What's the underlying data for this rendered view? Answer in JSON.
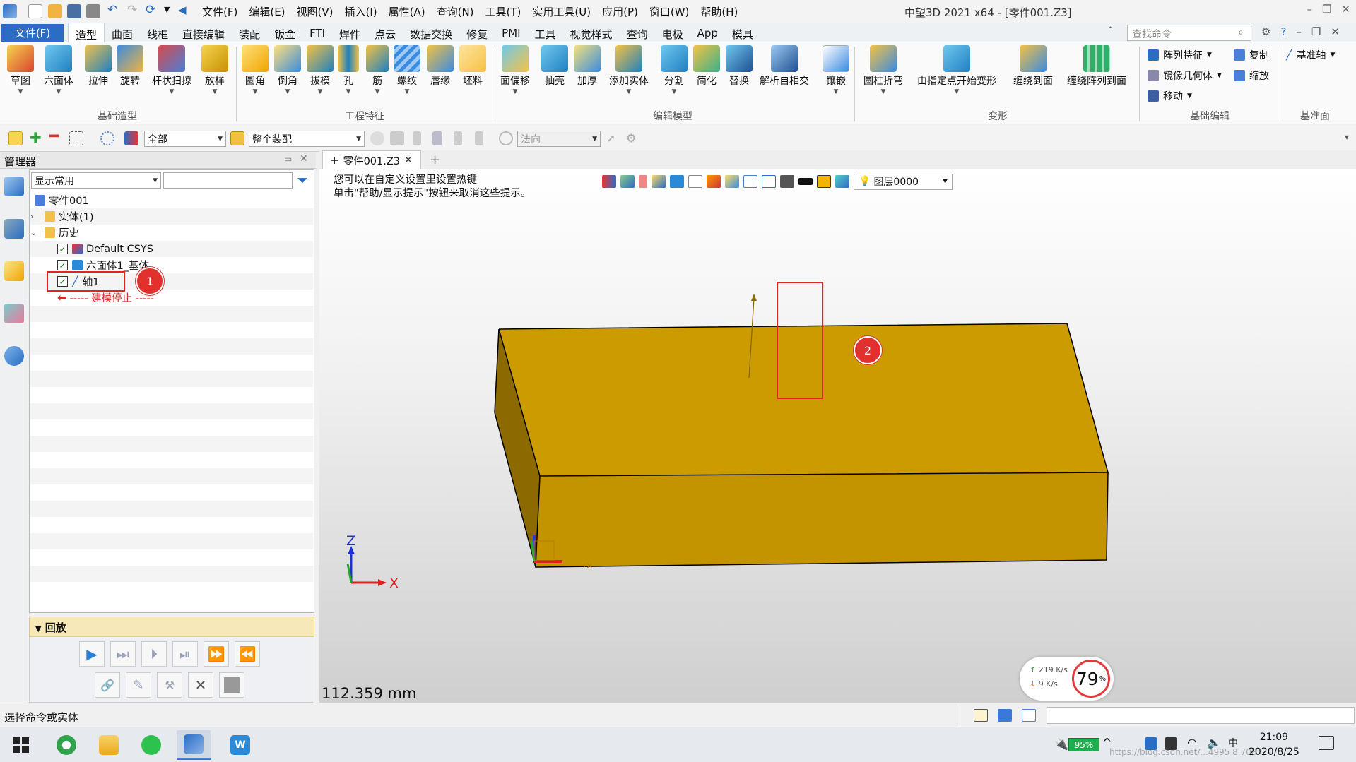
{
  "menu": [
    "文件(F)",
    "编辑(E)",
    "视图(V)",
    "插入(I)",
    "属性(A)",
    "查询(N)",
    "工具(T)",
    "实用工具(U)",
    "应用(P)",
    "窗口(W)",
    "帮助(H)"
  ],
  "window_title": "中望3D 2021 x64 - [零件001.Z3]",
  "tabs": {
    "file": "文件(F)",
    "items": [
      "造型",
      "曲面",
      "线框",
      "直接编辑",
      "装配",
      "钣金",
      "FTI",
      "焊件",
      "点云",
      "数据交换",
      "修复",
      "PMI",
      "工具",
      "视觉样式",
      "查询",
      "电极",
      "App",
      "模具"
    ],
    "active": "造型"
  },
  "search": {
    "placeholder": "查找命令"
  },
  "ribbon": {
    "groups": [
      "基础造型",
      "工程特征",
      "编辑模型",
      "变形",
      "基础编辑",
      "基准面"
    ],
    "basic": [
      "草图",
      "六面体",
      "拉伸",
      "旋转",
      "杆状扫掠",
      "放样"
    ],
    "engineering": [
      "圆角",
      "倒角",
      "拔模",
      "孔",
      "筋",
      "螺纹",
      "唇缘",
      "坯料"
    ],
    "edit": [
      "面偏移",
      "抽壳",
      "加厚",
      "添加实体",
      "分割",
      "简化",
      "替换",
      "解析自相交",
      "镶嵌"
    ],
    "deform": [
      "圆柱折弯",
      "由指定点开始变形",
      "缠绕到面",
      "缠绕阵列到面"
    ],
    "basic_edit": [
      "阵列特征",
      "复制",
      "镜像几何体",
      "缩放",
      "移动"
    ],
    "datum": [
      "基准轴"
    ]
  },
  "toolstrip": {
    "filter": "全部",
    "assembly": "整个装配",
    "normal": "法向"
  },
  "manager": {
    "title": "管理器",
    "display_combo": "显示常用",
    "tree": {
      "root": "零件001",
      "solids": "实体(1)",
      "history": "历史",
      "csys": "Default CSYS",
      "block": "六面体1_基体",
      "axis": "轴1",
      "stop": "----- 建模停止 -----"
    },
    "playback": "回放"
  },
  "doc_tab": "零件001.Z3",
  "hint": {
    "line1": "您可以在自定义设置里设置热键",
    "line2": "单击\"帮助/显示提示\"按钮来取消这些提示。"
  },
  "layer": "图层0000",
  "triad": {
    "z": "Z",
    "x": "X"
  },
  "measure": "112.359 mm",
  "net": {
    "up": "219 K/s",
    "down": "9  K/s",
    "percent": "79",
    "unit": "%"
  },
  "status": "选择命令或实体",
  "annotations": {
    "badge1": "1",
    "badge2": "2"
  },
  "clock": {
    "time": "21:09",
    "date": "2020/8/25"
  },
  "battery": "95%",
  "watermark": "https://blog.csdn.net/...4995 8.708",
  "colors": {
    "accent": "#2b6cc4",
    "solid_top": "#cc9b00",
    "solid_front": "#c49400",
    "solid_side": "#8c6a00",
    "highlight": "#e32222"
  }
}
